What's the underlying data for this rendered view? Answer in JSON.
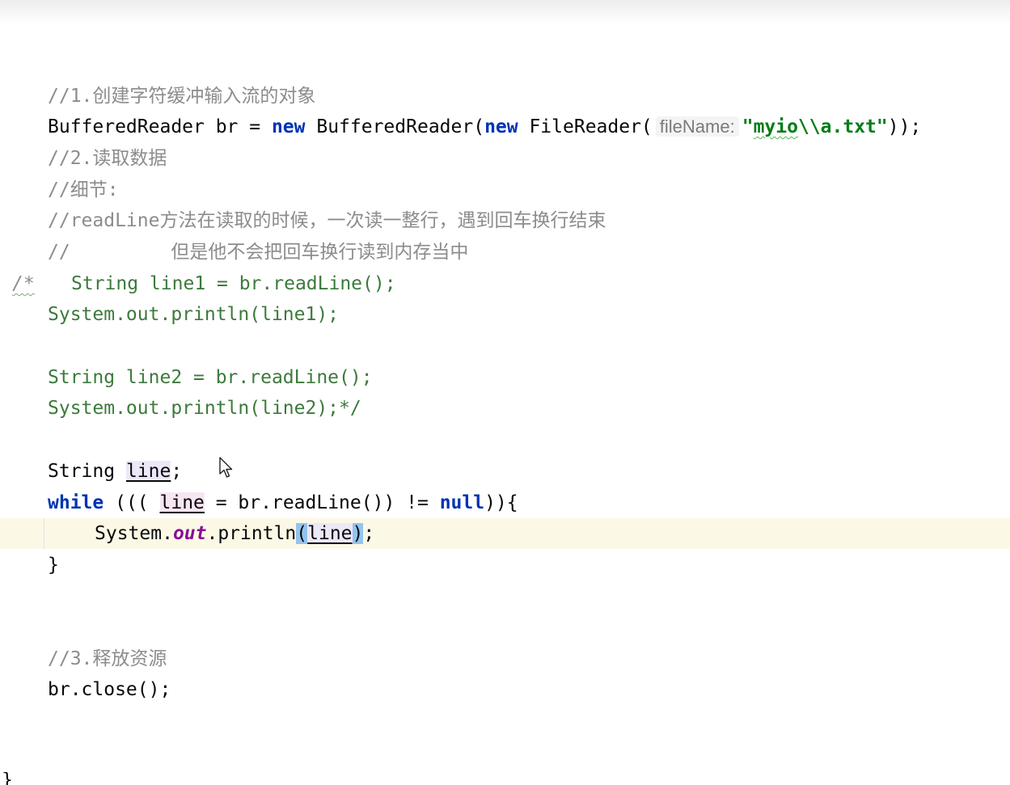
{
  "code": {
    "comment1": "//1.创建字符缓冲输入流的对象",
    "line_br": {
      "type": "BufferedReader br = ",
      "new1": "new",
      "ctor": " BufferedReader(",
      "new2": "new",
      "ctor2": " FileReader(",
      "hint": "fileName:",
      "str_quote_open": "\"",
      "str_myio": "myio",
      "str_rest": "\\\\a.txt\"",
      "end": "));"
    },
    "comment2": "//2.读取数据",
    "comment3": "//细节:",
    "comment4": "//readLine方法在读取的时候，一次读一整行，遇到回车换行结束",
    "comment5": "//         但是他不会把回车换行读到内存当中",
    "block_start_marker": "/*",
    "line_line1": "String line1 = br.readLine();",
    "line_print1": "System.out.println(line1);",
    "line_line2": "String line2 = br.readLine();",
    "line_print2": "System.out.println(line2);*/",
    "decl": {
      "type": "String ",
      "var": "line",
      "end": ";"
    },
    "while_line": {
      "kw": "while",
      "open": " ((( ",
      "var": "line",
      "mid": " = br.readLine()) != ",
      "null_kw": "null",
      "end": ")){"
    },
    "print_line": {
      "obj": "System.",
      "field": "out",
      "method": ".println",
      "paren_open": "(",
      "var": "line",
      "paren_close": ")",
      "end": ";"
    },
    "close_brace": "}",
    "comment6": "//3.释放资源",
    "close_line": "br.close();",
    "outer_brace": "}"
  },
  "colors": {
    "keyword": "#0033b3",
    "string": "#067d17",
    "comment": "#8c8c8c",
    "field": "#871094",
    "current_line": "#fcf8e6"
  }
}
